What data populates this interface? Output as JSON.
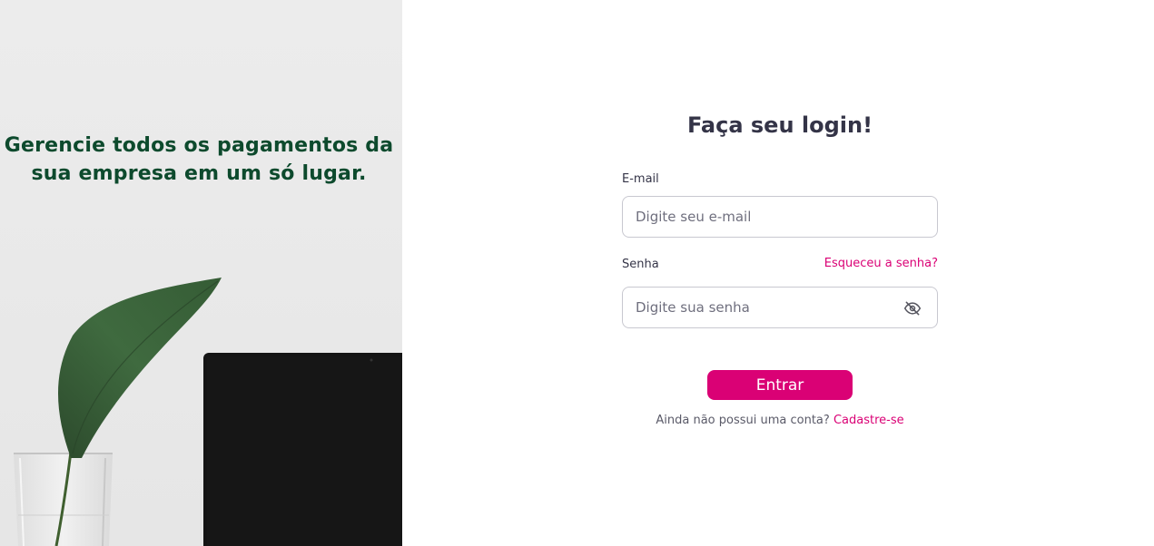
{
  "hero": {
    "tagline": "Gerencie todos os pagamentos da sua empresa em um só lugar.",
    "photo_icon": "leaf-laptop-photo"
  },
  "login": {
    "title": "Faça seu login!",
    "email_label": "E-mail",
    "email_placeholder": "Digite seu e-mail",
    "email_value": "",
    "password_label": "Senha",
    "forgot_link": "Esqueceu a senha?",
    "password_placeholder": "Digite sua senha",
    "password_value": "",
    "password_toggle_icon": "eye-off-icon",
    "submit_label": "Entrar",
    "signup_prompt": "Ainda não possui uma conta?",
    "signup_link": "Cadastre-se"
  },
  "colors": {
    "accent": "#da0175",
    "hero_text": "#0d4a2d",
    "text_dark": "#343447"
  }
}
